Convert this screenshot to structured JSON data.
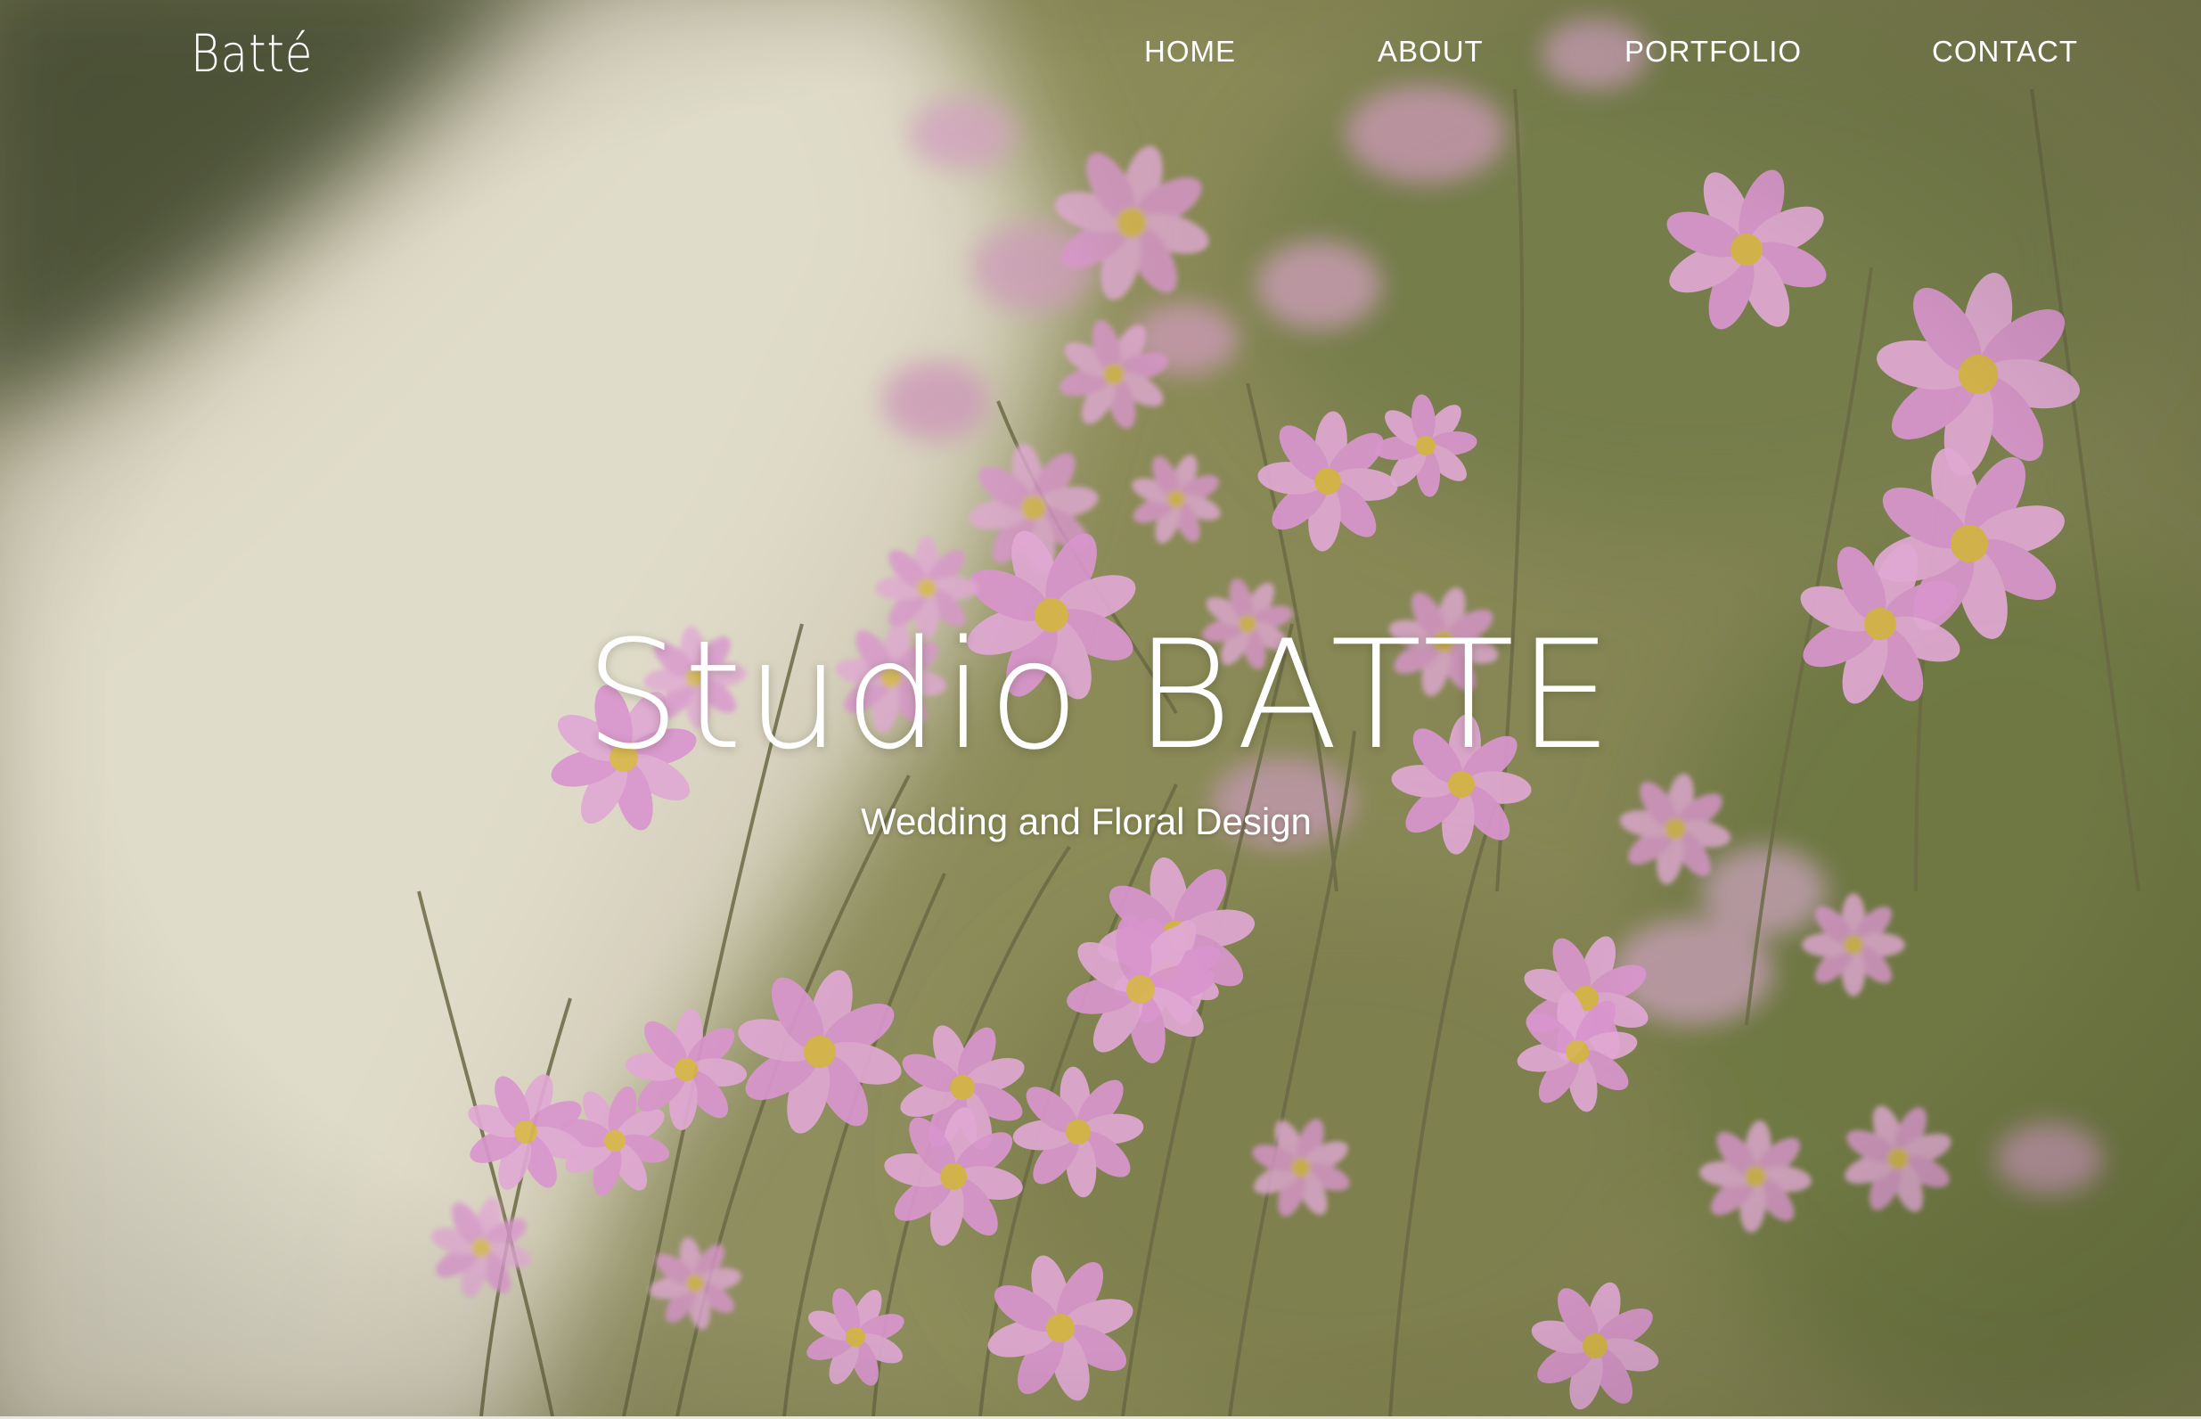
{
  "site": {
    "logo": "Batté"
  },
  "nav": {
    "items": [
      {
        "label": "HOME"
      },
      {
        "label": "ABOUT"
      },
      {
        "label": "PORTFOLIO"
      },
      {
        "label": "CONTACT"
      }
    ]
  },
  "hero": {
    "title": "Studio BATTE",
    "subtitle": "Wedding and Floral Design",
    "image": "pink cosmos flowers beside a path",
    "colors": {
      "path": "#d9d3c1",
      "foliage": "#7d7f4a",
      "flower": "#d88ccf",
      "flower_center": "#d8b23a"
    }
  },
  "colors": {
    "text": "#ffffff",
    "bottom_strip": "#e9e6e1"
  }
}
